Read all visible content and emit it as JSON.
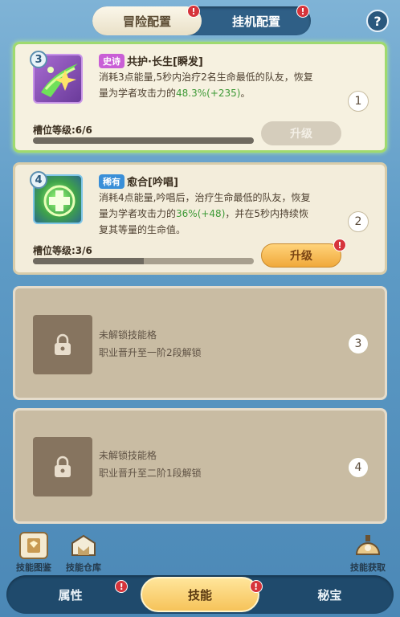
{
  "top_tabs": [
    {
      "label": "冒险配置",
      "active": true,
      "badge": "!"
    },
    {
      "label": "挂机配置",
      "active": false,
      "badge": "!"
    }
  ],
  "help_label": "?",
  "slots": [
    {
      "slot_number": "1",
      "skill_level": "3",
      "rarity": "史诗",
      "rarity_color": "#c95fd6",
      "name": "共护·长生[瞬发]",
      "desc_line1": "消耗3点能量,5秒内治疗2名生命最低的队友，恢复",
      "desc_line2_pre": "量为学者攻击力的",
      "desc_line2_pct": "48.3%",
      "desc_line2_bonus": "(+235)",
      "desc_line2_post": "。",
      "slot_level_label": "槽位等级:6/6",
      "slot_level_progress": 1.0,
      "upgrade_label": "升级",
      "upgrade_enabled": false
    },
    {
      "slot_number": "2",
      "skill_level": "4",
      "rarity": "稀有",
      "rarity_color": "#3a8fd8",
      "name": "愈合[吟唱]",
      "desc_line1": "消耗4点能量,吟唱后，治疗生命最低的队友，恢复",
      "desc_line2_pre": "量为学者攻击力的",
      "desc_line2_pct": "36%",
      "desc_line2_bonus": "(+48)",
      "desc_line2_post": "，并在5秒内持续恢",
      "desc_line3": "复其等量的生命值。",
      "slot_level_label": "槽位等级:3/6",
      "slot_level_progress": 0.5,
      "upgrade_label": "升级",
      "upgrade_enabled": true,
      "upgrade_badge": "!"
    },
    {
      "slot_number": "3",
      "locked_title": "未解锁技能格",
      "locked_hint": "职业晋升至一阶2段解锁"
    },
    {
      "slot_number": "4",
      "locked_title": "未解锁技能格",
      "locked_hint": "职业晋升至二阶1段解锁"
    }
  ],
  "bottom_icons": [
    {
      "label": "技能图鉴",
      "icon": "book-icon"
    },
    {
      "label": "技能仓库",
      "icon": "warehouse-icon"
    },
    {
      "label": "技能获取",
      "icon": "dome-icon"
    }
  ],
  "bottom_nav": [
    {
      "label": "属性",
      "badge": "!"
    },
    {
      "label": "技能",
      "active": true,
      "badge": "!"
    },
    {
      "label": "秘宝"
    }
  ]
}
